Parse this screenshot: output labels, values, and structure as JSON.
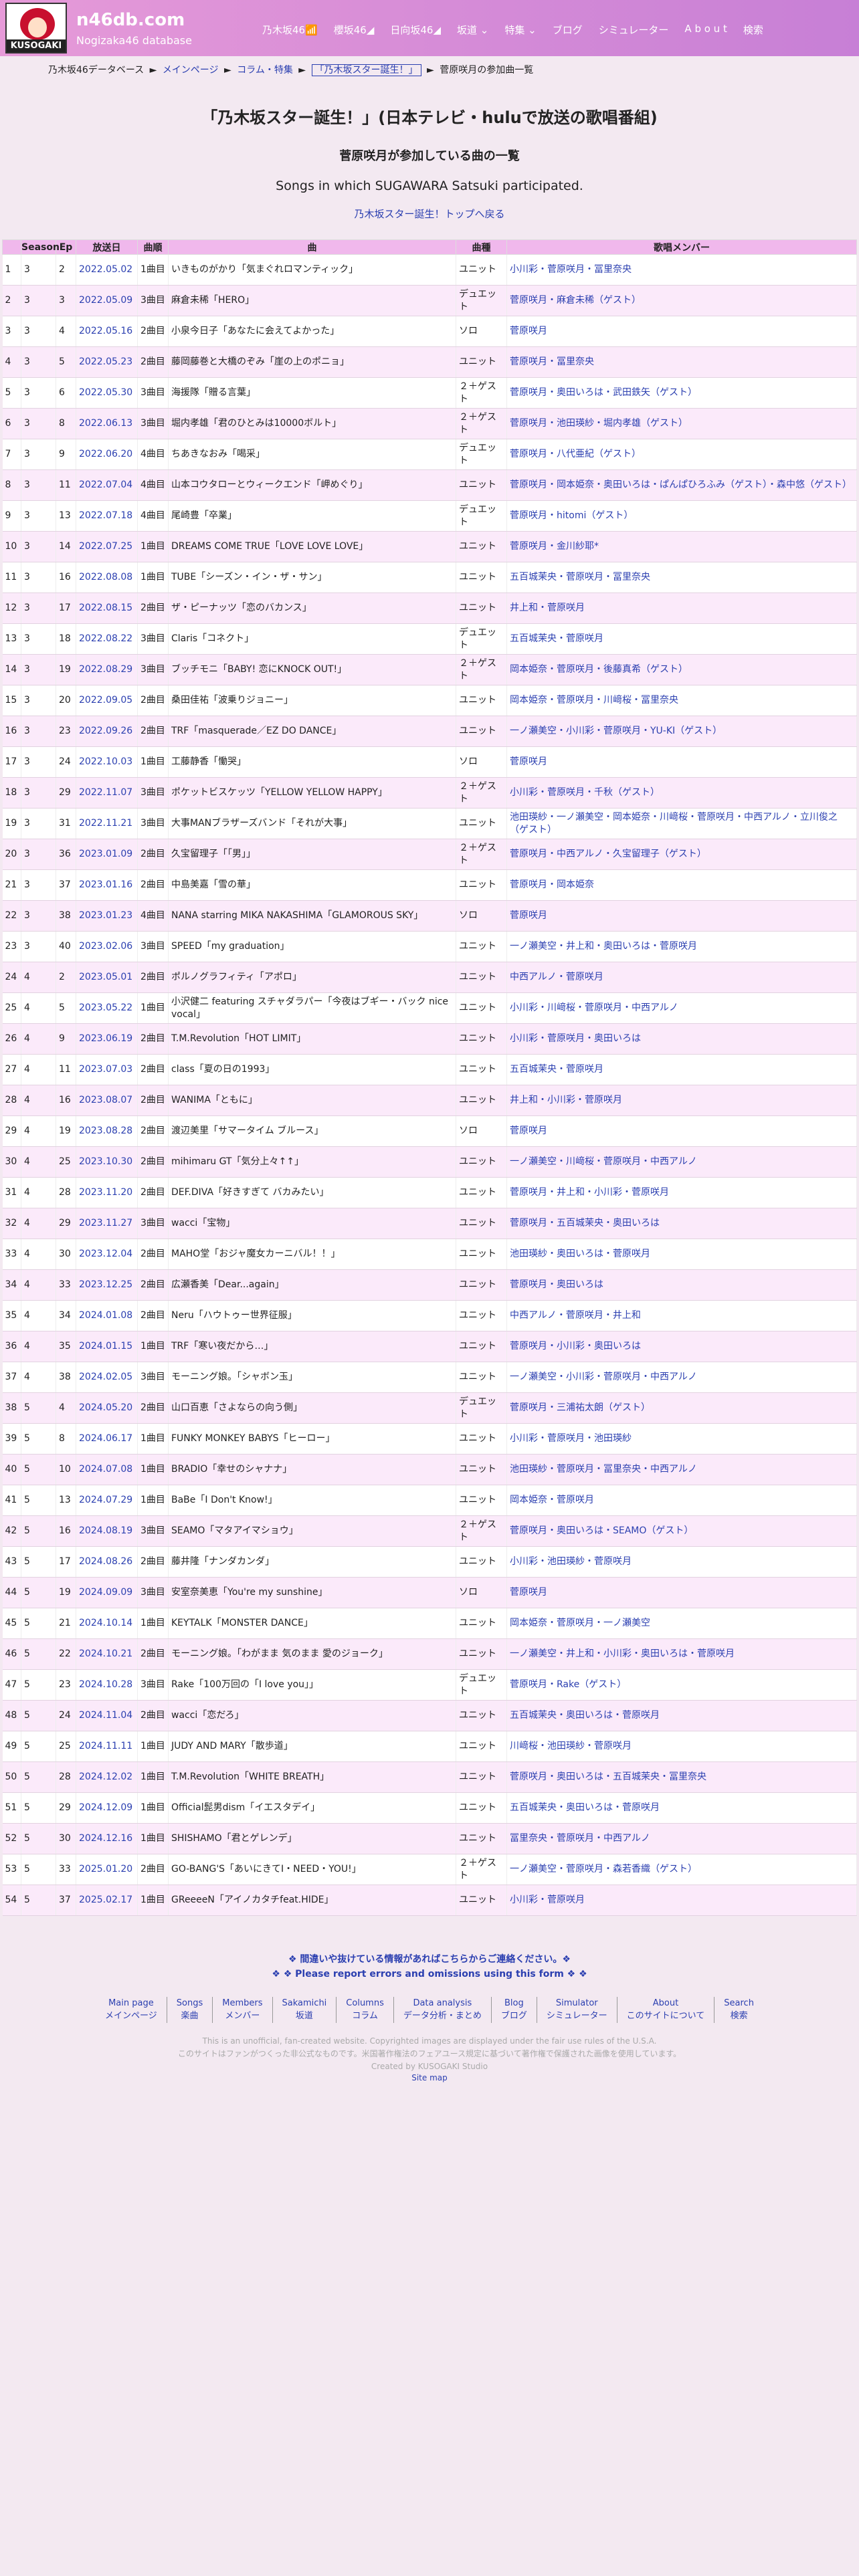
{
  "header": {
    "logo_text": "KUSOGAKI",
    "site_name": "n46db.com",
    "site_sub": "Nogizaka46 database",
    "nav": [
      "乃木坂46📶",
      "櫻坂46◢",
      "日向坂46◢",
      "坂道 ⌄",
      "特集 ⌄",
      "ブログ",
      "シミュレーター",
      "A b o u t",
      "検索"
    ]
  },
  "breadcrumb": {
    "items": [
      "乃木坂46データベース",
      "メインページ",
      "コラム・特集"
    ],
    "current": "「乃木坂スター誕生！」",
    "last": "菅原咲月の参加曲一覧",
    "sep": "►"
  },
  "title": "「乃木坂スター誕生！」(日本テレビ・huluで放送の歌唱番組)",
  "subtitle": "菅原咲月が参加している曲の一覧",
  "en_subtitle": "Songs in which SUGAWARA Satsuki participated.",
  "back_link": "乃木坂スター誕生！トップへ戻る",
  "table": {
    "headers": [
      "",
      "Season",
      "Ep",
      "放送日",
      "曲順",
      "曲",
      "曲種",
      "歌唱メンバー"
    ],
    "rows": [
      [
        "1",
        "3",
        "2",
        "2022.05.02",
        "1曲目",
        "いきものがかり「気まぐれロマンティック」",
        "ユニット",
        "小川彩・菅原咲月・冨里奈央"
      ],
      [
        "2",
        "3",
        "3",
        "2022.05.09",
        "3曲目",
        "麻倉未稀「HERO」",
        "デュエット",
        "菅原咲月・麻倉未稀（ゲスト）"
      ],
      [
        "3",
        "3",
        "4",
        "2022.05.16",
        "2曲目",
        "小泉今日子「あなたに会えてよかった」",
        "ソロ",
        "菅原咲月"
      ],
      [
        "4",
        "3",
        "5",
        "2022.05.23",
        "2曲目",
        "藤岡藤巻と大橋のぞみ「崖の上のポニョ」",
        "ユニット",
        "菅原咲月・冨里奈央"
      ],
      [
        "5",
        "3",
        "6",
        "2022.05.30",
        "3曲目",
        "海援隊「贈る言葉」",
        "２＋ゲスト",
        "菅原咲月・奥田いろは・武田鉄矢（ゲスト）"
      ],
      [
        "6",
        "3",
        "8",
        "2022.06.13",
        "3曲目",
        "堀内孝雄「君のひとみは10000ボルト」",
        "２＋ゲスト",
        "菅原咲月・池田瑛紗・堀内孝雄（ゲスト）"
      ],
      [
        "7",
        "3",
        "9",
        "2022.06.20",
        "4曲目",
        "ちあきなおみ「喝采」",
        "デュエット",
        "菅原咲月・八代亜紀（ゲスト）"
      ],
      [
        "8",
        "3",
        "11",
        "2022.07.04",
        "4曲目",
        "山本コウタローとウィークエンド「岬めぐり」",
        "ユニット",
        "菅原咲月・岡本姫奈・奥田いろは・ぱんぱひろふみ（ゲスト）・森中悠（ゲスト）"
      ],
      [
        "9",
        "3",
        "13",
        "2022.07.18",
        "4曲目",
        "尾崎豊「卒業」",
        "デュエット",
        "菅原咲月・hitomi（ゲスト）"
      ],
      [
        "10",
        "3",
        "14",
        "2022.07.25",
        "1曲目",
        "DREAMS COME TRUE「LOVE LOVE LOVE」",
        "ユニット",
        "菅原咲月・金川紗耶*"
      ],
      [
        "11",
        "3",
        "16",
        "2022.08.08",
        "1曲目",
        "TUBE「シーズン・イン・ザ・サン」",
        "ユニット",
        "五百城茉央・菅原咲月・冨里奈央"
      ],
      [
        "12",
        "3",
        "17",
        "2022.08.15",
        "2曲目",
        "ザ・ピーナッツ「恋のバカンス」",
        "ユニット",
        "井上和・菅原咲月"
      ],
      [
        "13",
        "3",
        "18",
        "2022.08.22",
        "3曲目",
        "Claris「コネクト」",
        "デュエット",
        "五百城茉央・菅原咲月"
      ],
      [
        "14",
        "3",
        "19",
        "2022.08.29",
        "3曲目",
        "ブッチモニ「BABY! 恋にKNOCK OUT!」",
        "２＋ゲスト",
        "岡本姫奈・菅原咲月・後藤真希（ゲスト）"
      ],
      [
        "15",
        "3",
        "20",
        "2022.09.05",
        "2曲目",
        "桑田佳祐「波乗りジョニー」",
        "ユニット",
        "岡本姫奈・菅原咲月・川﨑桜・冨里奈央"
      ],
      [
        "16",
        "3",
        "23",
        "2022.09.26",
        "2曲目",
        "TRF「masquerade／EZ DO DANCE」",
        "ユニット",
        "一ノ瀬美空・小川彩・菅原咲月・YU-KI（ゲスト）"
      ],
      [
        "17",
        "3",
        "24",
        "2022.10.03",
        "1曲目",
        "工藤静香「慟哭」",
        "ソロ",
        "菅原咲月"
      ],
      [
        "18",
        "3",
        "29",
        "2022.11.07",
        "3曲目",
        "ポケットビスケッツ「YELLOW YELLOW HAPPY」",
        "２＋ゲスト",
        "小川彩・菅原咲月・千秋（ゲスト）"
      ],
      [
        "19",
        "3",
        "31",
        "2022.11.21",
        "3曲目",
        "大事MANブラザーズバンド「それが大事」",
        "ユニット",
        "池田瑛紗・一ノ瀬美空・岡本姫奈・川﨑桜・菅原咲月・中西アルノ・立川俊之（ゲスト）"
      ],
      [
        "20",
        "3",
        "36",
        "2023.01.09",
        "2曲目",
        "久宝留理子「「男」」",
        "２＋ゲスト",
        "菅原咲月・中西アルノ・久宝留理子（ゲスト）"
      ],
      [
        "21",
        "3",
        "37",
        "2023.01.16",
        "2曲目",
        "中島美嘉「雪の華」",
        "ユニット",
        "菅原咲月・岡本姫奈"
      ],
      [
        "22",
        "3",
        "38",
        "2023.01.23",
        "4曲目",
        "NANA starring MIKA NAKASHIMA「GLAMOROUS SKY」",
        "ソロ",
        "菅原咲月"
      ],
      [
        "23",
        "3",
        "40",
        "2023.02.06",
        "3曲目",
        "SPEED「my graduation」",
        "ユニット",
        "一ノ瀬美空・井上和・奥田いろは・菅原咲月"
      ],
      [
        "24",
        "4",
        "2",
        "2023.05.01",
        "2曲目",
        "ポルノグラフィティ「アポロ」",
        "ユニット",
        "中西アルノ・菅原咲月"
      ],
      [
        "25",
        "4",
        "5",
        "2023.05.22",
        "1曲目",
        "小沢健二 featuring スチャダラパー「今夜はブギー・バック nice vocal」",
        "ユニット",
        "小川彩・川﨑桜・菅原咲月・中西アルノ"
      ],
      [
        "26",
        "4",
        "9",
        "2023.06.19",
        "2曲目",
        "T.M.Revolution「HOT LIMIT」",
        "ユニット",
        "小川彩・菅原咲月・奥田いろは"
      ],
      [
        "27",
        "4",
        "11",
        "2023.07.03",
        "2曲目",
        "class「夏の日の1993」",
        "ユニット",
        "五百城茉央・菅原咲月"
      ],
      [
        "28",
        "4",
        "16",
        "2023.08.07",
        "2曲目",
        "WANIMA「ともに」",
        "ユニット",
        "井上和・小川彩・菅原咲月"
      ],
      [
        "29",
        "4",
        "19",
        "2023.08.28",
        "2曲目",
        "渡辺美里「サマータイム ブルース」",
        "ソロ",
        "菅原咲月"
      ],
      [
        "30",
        "4",
        "25",
        "2023.10.30",
        "2曲目",
        "mihimaru GT「気分上々↑↑」",
        "ユニット",
        "一ノ瀬美空・川﨑桜・菅原咲月・中西アルノ"
      ],
      [
        "31",
        "4",
        "28",
        "2023.11.20",
        "2曲目",
        "DEF.DIVA「好きすぎて バカみたい」",
        "ユニット",
        "菅原咲月・井上和・小川彩・菅原咲月"
      ],
      [
        "32",
        "4",
        "29",
        "2023.11.27",
        "3曲目",
        "wacci「宝物」",
        "ユニット",
        "菅原咲月・五百城茉央・奥田いろは"
      ],
      [
        "33",
        "4",
        "30",
        "2023.12.04",
        "2曲目",
        "MAHO堂「おジャ魔女カーニバル！！」",
        "ユニット",
        "池田瑛紗・奥田いろは・菅原咲月"
      ],
      [
        "34",
        "4",
        "33",
        "2023.12.25",
        "2曲目",
        "広瀬香美「Dear...again」",
        "ユニット",
        "菅原咲月・奥田いろは"
      ],
      [
        "35",
        "4",
        "34",
        "2024.01.08",
        "2曲目",
        "Neru「ハウトゥー世界征服」",
        "ユニット",
        "中西アルノ・菅原咲月・井上和"
      ],
      [
        "36",
        "4",
        "35",
        "2024.01.15",
        "1曲目",
        "TRF「寒い夜だから…」",
        "ユニット",
        "菅原咲月・小川彩・奥田いろは"
      ],
      [
        "37",
        "4",
        "38",
        "2024.02.05",
        "3曲目",
        "モーニング娘。「シャボン玉」",
        "ユニット",
        "一ノ瀬美空・小川彩・菅原咲月・中西アルノ"
      ],
      [
        "38",
        "5",
        "4",
        "2024.05.20",
        "2曲目",
        "山口百恵「さよならの向う側」",
        "デュエット",
        "菅原咲月・三浦祐太朗（ゲスト）"
      ],
      [
        "39",
        "5",
        "8",
        "2024.06.17",
        "1曲目",
        "FUNKY MONKEY BABYS「ヒーロー」",
        "ユニット",
        "小川彩・菅原咲月・池田瑛紗"
      ],
      [
        "40",
        "5",
        "10",
        "2024.07.08",
        "1曲目",
        "BRADIO「幸せのシャナナ」",
        "ユニット",
        "池田瑛紗・菅原咲月・冨里奈央・中西アルノ"
      ],
      [
        "41",
        "5",
        "13",
        "2024.07.29",
        "1曲目",
        "BaBe「I Don't Know!」",
        "ユニット",
        "岡本姫奈・菅原咲月"
      ],
      [
        "42",
        "5",
        "16",
        "2024.08.19",
        "3曲目",
        "SEAMO「マタアイマショウ」",
        "２＋ゲスト",
        "菅原咲月・奥田いろは・SEAMO（ゲスト）"
      ],
      [
        "43",
        "5",
        "17",
        "2024.08.26",
        "2曲目",
        "藤井隆「ナンダカンダ」",
        "ユニット",
        "小川彩・池田瑛紗・菅原咲月"
      ],
      [
        "44",
        "5",
        "19",
        "2024.09.09",
        "3曲目",
        "安室奈美恵「You're my sunshine」",
        "ソロ",
        "菅原咲月"
      ],
      [
        "45",
        "5",
        "21",
        "2024.10.14",
        "1曲目",
        "KEYTALK「MONSTER DANCE」",
        "ユニット",
        "岡本姫奈・菅原咲月・一ノ瀬美空"
      ],
      [
        "46",
        "5",
        "22",
        "2024.10.21",
        "2曲目",
        "モーニング娘。「わがまま 気のまま 愛のジョーク」",
        "ユニット",
        "一ノ瀬美空・井上和・小川彩・奥田いろは・菅原咲月"
      ],
      [
        "47",
        "5",
        "23",
        "2024.10.28",
        "3曲目",
        "Rake「100万回の「I love you」」",
        "デュエット",
        "菅原咲月・Rake（ゲスト）"
      ],
      [
        "48",
        "5",
        "24",
        "2024.11.04",
        "2曲目",
        "wacci「恋だろ」",
        "ユニット",
        "五百城茉央・奥田いろは・菅原咲月"
      ],
      [
        "49",
        "5",
        "25",
        "2024.11.11",
        "1曲目",
        "JUDY AND MARY「散歩道」",
        "ユニット",
        "川﨑桜・池田瑛紗・菅原咲月"
      ],
      [
        "50",
        "5",
        "28",
        "2024.12.02",
        "1曲目",
        "T.M.Revolution「WHITE BREATH」",
        "ユニット",
        "菅原咲月・奥田いろは・五百城茉央・冨里奈央"
      ],
      [
        "51",
        "5",
        "29",
        "2024.12.09",
        "1曲目",
        "Official髭男dism「イエスタデイ」",
        "ユニット",
        "五百城茉央・奥田いろは・菅原咲月"
      ],
      [
        "52",
        "5",
        "30",
        "2024.12.16",
        "1曲目",
        "SHISHAMO「君とゲレンデ」",
        "ユニット",
        "冨里奈央・菅原咲月・中西アルノ"
      ],
      [
        "53",
        "5",
        "33",
        "2025.01.20",
        "2曲目",
        "GO-BANG'S「あいにきてI・NEED・YOU!」",
        "２＋ゲスト",
        "一ノ瀬美空・菅原咲月・森若香織（ゲスト）"
      ],
      [
        "54",
        "5",
        "37",
        "2025.02.17",
        "1曲目",
        "GReeeeN「アイノカタチfeat.HIDE」",
        "ユニット",
        "小川彩・菅原咲月"
      ]
    ]
  },
  "report": {
    "jp": "❖ 間違いや抜けている情報があればこちらからご連絡ください。❖",
    "en": "❖ ❖ Please report errors and omissions using this form ❖ ❖"
  },
  "footer": [
    {
      "en": "Main page",
      "jp": "メインページ"
    },
    {
      "en": "Songs",
      "jp": "楽曲"
    },
    {
      "en": "Members",
      "jp": "メンバー"
    },
    {
      "en": "Sakamichi",
      "jp": "坂道"
    },
    {
      "en": "Columns",
      "jp": "コラム"
    },
    {
      "en": "Data analysis",
      "jp": "データ分析・まとめ"
    },
    {
      "en": "Blog",
      "jp": "ブログ"
    },
    {
      "en": "Simulator",
      "jp": "シミュレーター"
    },
    {
      "en": "About",
      "jp": "このサイトについて"
    },
    {
      "en": "Search",
      "jp": "検索"
    }
  ],
  "notes": [
    "This is an unofficial, fan-created website. Copyrighted images are displayed under the fair use rules of the U.S.A.",
    "このサイトはファンがつくった非公式なものです。米国著作権法のフェアユース規定に基づいて著作権で保護された画像を使用しています。",
    "Created by KUSOGAKI Studio"
  ],
  "sitemap": "Site map"
}
